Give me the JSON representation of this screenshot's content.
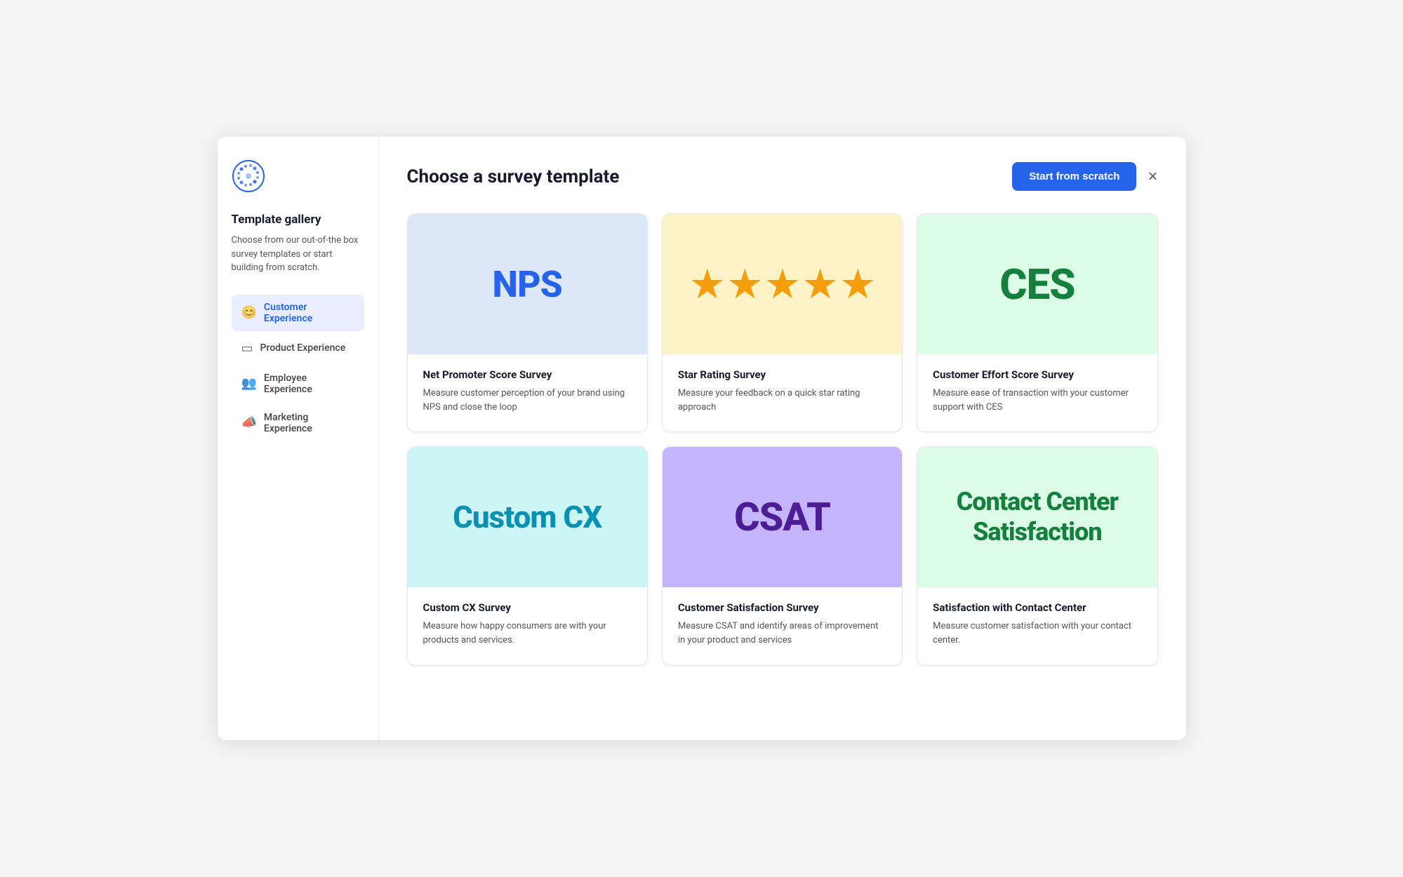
{
  "modal": {
    "title": "Choose a survey template"
  },
  "header": {
    "start_scratch_label": "Start from scratch",
    "close_label": "×"
  },
  "sidebar": {
    "title": "Template gallery",
    "description": "Choose from our out-of-the box survey templates or start building from scratch.",
    "nav_items": [
      {
        "id": "customer-experience",
        "label": "Customer Experience",
        "icon": "😊",
        "active": true
      },
      {
        "id": "product-experience",
        "label": "Product Experience",
        "icon": "▭",
        "active": false
      },
      {
        "id": "employee-experience",
        "label": "Employee Experience",
        "icon": "👥",
        "active": false
      },
      {
        "id": "marketing-experience",
        "label": "Marketing Experience",
        "icon": "📣",
        "active": false
      }
    ]
  },
  "templates": [
    {
      "id": "nps",
      "preview_type": "nps",
      "preview_text": "NPS",
      "title": "Net Promoter Score Survey",
      "description": "Measure customer perception of your brand using NPS and close the loop"
    },
    {
      "id": "star-rating",
      "preview_type": "star",
      "preview_text": "★★★★★",
      "title": "Star Rating Survey",
      "description": "Measure your feedback on a quick star rating approach"
    },
    {
      "id": "ces",
      "preview_type": "ces",
      "preview_text": "CES",
      "title": "Customer Effort Score Survey",
      "description": "Measure ease of transaction with your customer support with CES"
    },
    {
      "id": "custom-cx",
      "preview_type": "custom-cx",
      "preview_text": "Custom CX",
      "title": "Custom CX Survey",
      "description": "Measure how happy consumers are with your products and services."
    },
    {
      "id": "csat",
      "preview_type": "csat",
      "preview_text": "CSAT",
      "title": "Customer Satisfaction Survey",
      "description": "Measure CSAT and identify areas of improvement in your product and services"
    },
    {
      "id": "contact-center",
      "preview_type": "contact",
      "preview_text": "Contact Center Satisfaction",
      "title": "Satisfaction with Contact Center",
      "description": "Measure customer satisfaction with your contact center."
    }
  ],
  "logo": {
    "alt": "Qualtrics logo"
  }
}
